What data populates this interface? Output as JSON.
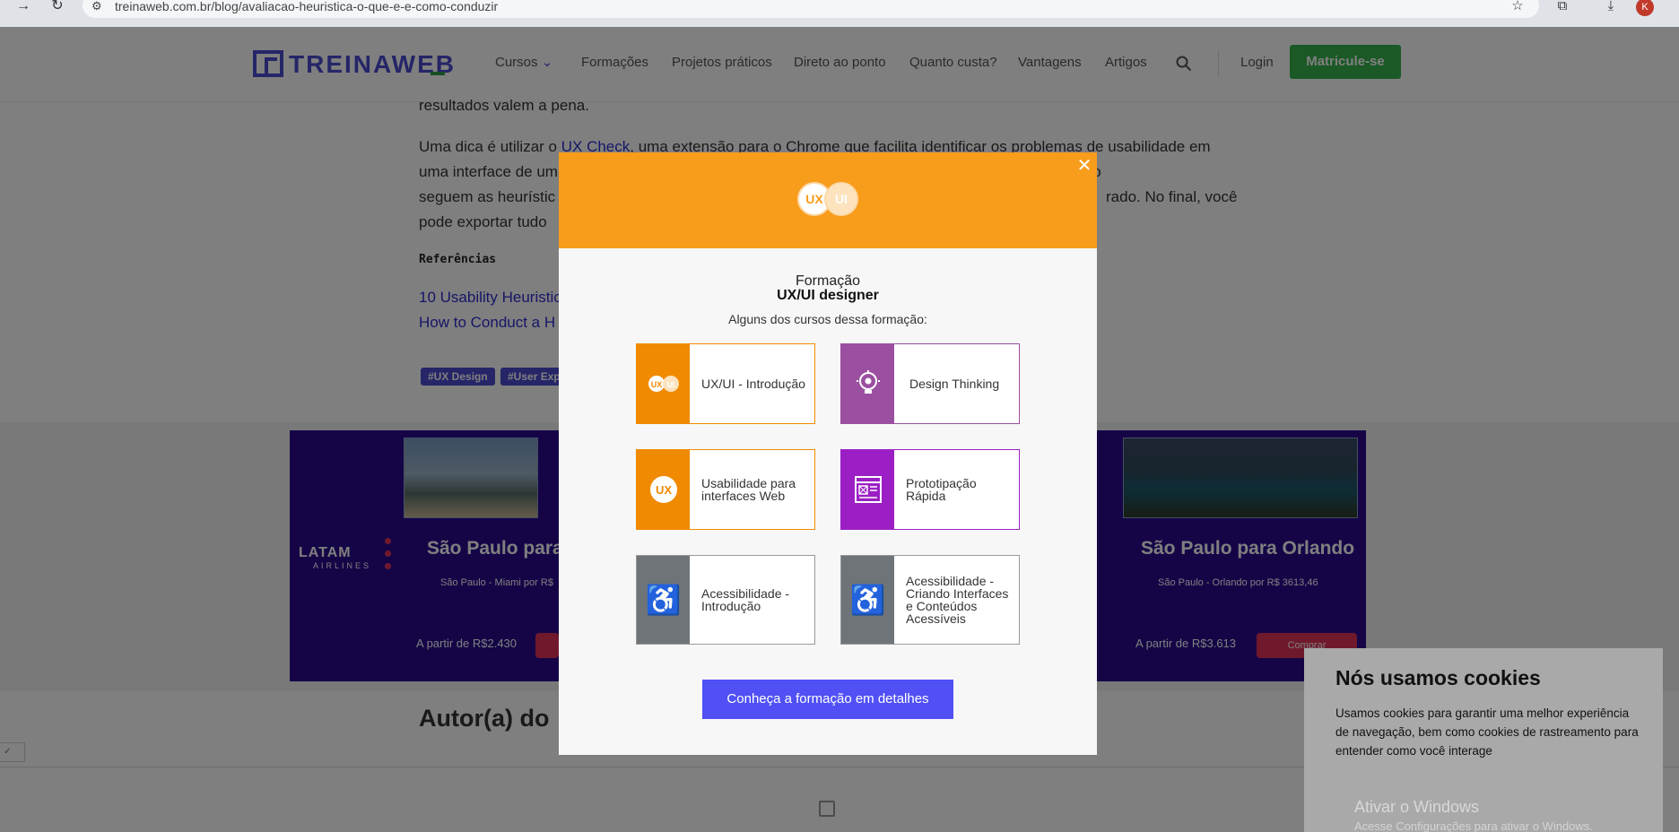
{
  "browser": {
    "back_icon": "arrow-right-icon",
    "reload_icon": "reload-icon",
    "url": "treinaweb.com.br/blog/avaliacao-heuristica-o-que-e-e-como-conduzir",
    "profile_initial": "K"
  },
  "header": {
    "logo_text": "TREINAWEB",
    "nav": [
      "Cursos",
      "Formações",
      "Projetos práticos",
      "Direto ao ponto",
      "Quanto custa?",
      "Vantagens",
      "Artigos"
    ],
    "login": "Login",
    "enroll": "Matricule-se"
  },
  "article": {
    "para_prev_tail": "resultados valem a pena.",
    "tip_lines": [
      "Uma dica é utilizar o ",
      "UX Check",
      ", uma extensão para o Chrome que facilita identificar os problemas de usabilidade em",
      "uma interface de um",
      "entos que não",
      "seguem as heurístic",
      "rado. No final, você",
      "pode exportar tudo"
    ],
    "refs_title": "Referências",
    "ref1": "10 Usability Heuristic",
    "ref2": "How to Conduct a H",
    "tags": [
      "#UX Design",
      "#User Exp"
    ],
    "author_heading": "Autor(a) do"
  },
  "ad": {
    "brand": "LATAM",
    "brand_sub": "AIRLINES",
    "left": {
      "route": "São Paulo para",
      "sub": "São Paulo - Miami por R$",
      "price": "A partir de R$2.430"
    },
    "right": {
      "route": "São Paulo para Orlando",
      "sub": "São Paulo - Orlando por R$ 3613,46",
      "price": "A partir de R$3.613",
      "buy": "Comprar"
    }
  },
  "modal": {
    "badge_left": "UX",
    "badge_right": "UI",
    "kicker": "Formação",
    "title": "UX/UI designer",
    "subtitle": "Alguns dos cursos dessa formação:",
    "courses": [
      {
        "label": "UX/UI - Introdução",
        "color": "#f08a00",
        "icon": "uxui-icon"
      },
      {
        "label": "Design Thinking",
        "color": "#9b4fa0",
        "icon": "lightbulb-gear-icon"
      },
      {
        "label": "Usabilidade para interfaces Web",
        "color": "#f08a00",
        "icon": "ux-icon"
      },
      {
        "label": "Prototipação Rápida",
        "color": "#9b1fc4",
        "icon": "wireframe-icon"
      },
      {
        "label": "Acessibilidade - Introdução",
        "color": "#6e7478",
        "icon": "wheelchair-icon"
      },
      {
        "label": "Acessibilidade - Criando Interfaces e Conteúdos Acessíveis",
        "color": "#6e7478",
        "icon": "wheelchair-icon"
      }
    ],
    "cta": "Conheça a formação em detalhes"
  },
  "cookie": {
    "title": "Nós usamos cookies",
    "text": "Usamos cookies para garantir uma melhor experiência de navegação, bem como cookies de rastreamento para entender como você interage"
  },
  "windows": {
    "title": "Ativar o Windows",
    "sub": "Acesse Configurações para ativar o Windows."
  }
}
